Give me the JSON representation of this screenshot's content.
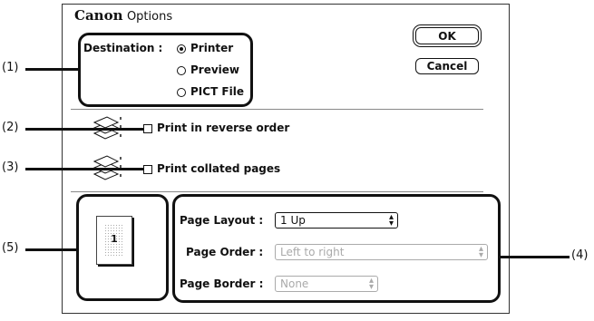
{
  "dialog": {
    "brand": "Canon",
    "title": "Options"
  },
  "buttons": {
    "ok": "OK",
    "cancel": "Cancel"
  },
  "destination": {
    "label": "Destination :",
    "options": [
      {
        "label": "Printer",
        "selected": true
      },
      {
        "label": "Preview",
        "selected": false
      },
      {
        "label": "PICT File",
        "selected": false
      }
    ]
  },
  "checkboxes": {
    "reverse": {
      "label": "Print in reverse order",
      "checked": false
    },
    "collated": {
      "label": "Print collated pages",
      "checked": false
    }
  },
  "page_layout": {
    "label": "Page Layout :",
    "value": "1 Up"
  },
  "page_order": {
    "label": "Page Order :",
    "value": "Left to right",
    "disabled": true
  },
  "page_border": {
    "label": "Page Border :",
    "value": "None",
    "disabled": true
  },
  "preview": {
    "page_number": "1"
  },
  "callouts": [
    "(1)",
    "(2)",
    "(3)",
    "(4)",
    "(5)"
  ],
  "icons": [
    "reverse-order-stack-icon",
    "collated-stack-icon",
    "popup-arrows-icon"
  ]
}
